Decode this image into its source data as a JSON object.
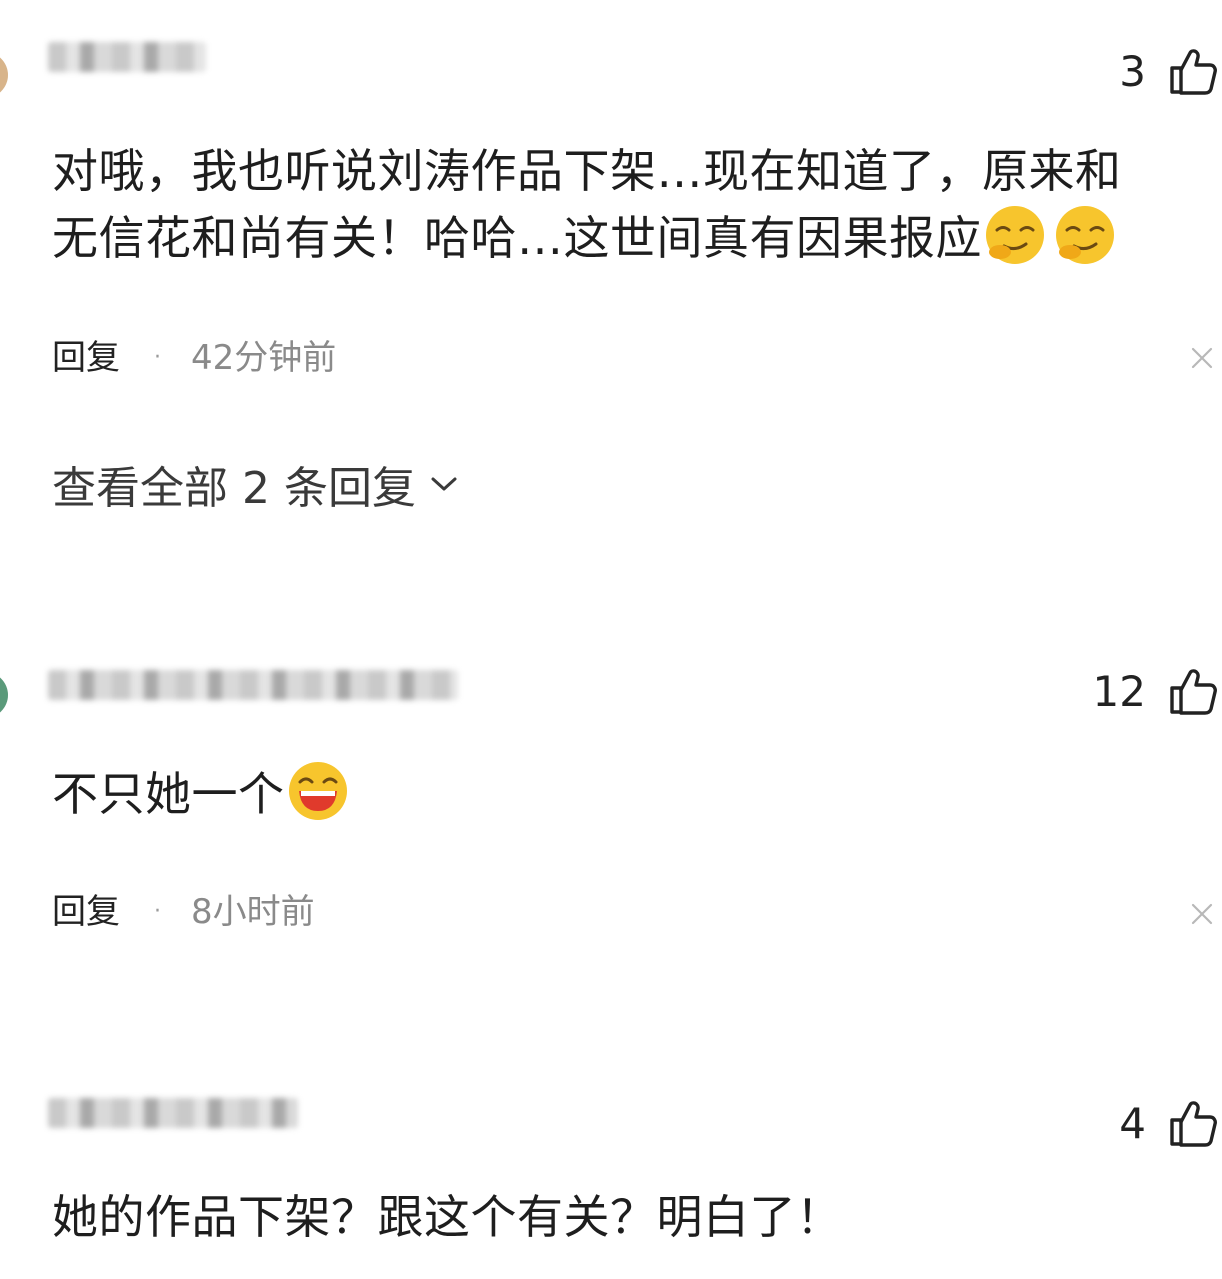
{
  "comments": [
    {
      "likes": "3",
      "text_line1": "对哦，我也听说刘涛作品下架…现在知道了，原来和",
      "text_line2": "无信花和尚有关！哈哈…这世间真有因果报应",
      "reply_label": "回复",
      "time": "42分钟前",
      "view_replies": "查看全部 2 条回复"
    },
    {
      "likes": "12",
      "text": "不只她一个",
      "reply_label": "回复",
      "time": "8小时前"
    },
    {
      "likes": "4",
      "text": "她的作品下架？跟这个有关？明白了！"
    }
  ],
  "icons": {
    "like": "thumbs-up-icon",
    "close": "close-icon",
    "expand": "chevron-down-icon",
    "emoji_smirk": "smirk-emoji",
    "emoji_laugh": "laugh-emoji"
  },
  "colors": {
    "text": "#1e1e1e",
    "meta": "#8a8a8a",
    "emoji_yellow": "#f7c52d"
  }
}
